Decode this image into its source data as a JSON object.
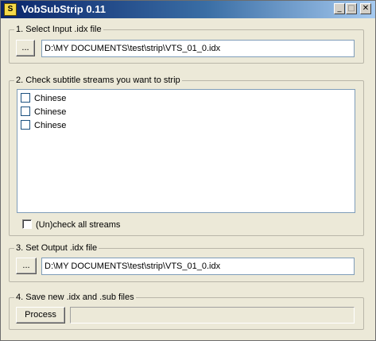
{
  "window": {
    "title": "VobSubStrip 0.11",
    "icon": "S",
    "controls": {
      "minimize": "_",
      "maximize": "□",
      "close": "✕"
    }
  },
  "section1": {
    "label": "1. Select Input .idx file",
    "browse_label": "...",
    "path": "D:\\MY DOCUMENTS\\test\\strip\\VTS_01_0.idx"
  },
  "section2": {
    "label": "2. Check subtitle streams you want to strip",
    "streams": [
      {
        "label": "Chinese",
        "checked": false
      },
      {
        "label": "Chinese",
        "checked": false
      },
      {
        "label": "Chinese",
        "checked": false
      }
    ],
    "check_all_label": "(Un)check all streams"
  },
  "section3": {
    "label": "3. Set Output .idx file",
    "browse_label": "...",
    "path": "D:\\MY DOCUMENTS\\test\\strip\\VTS_01_0.idx"
  },
  "section4": {
    "label": "4. Save new .idx and .sub files",
    "process_label": "Process",
    "progress": 0
  }
}
